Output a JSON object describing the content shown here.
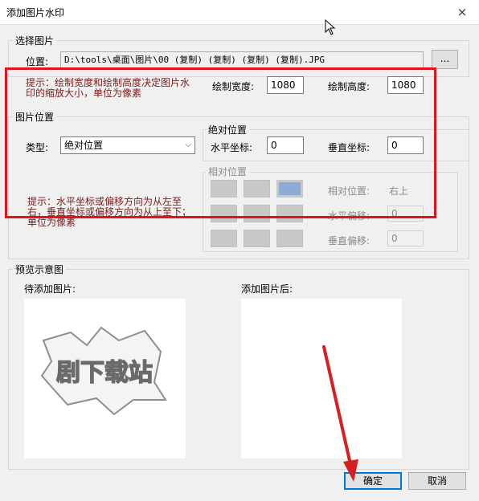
{
  "window": {
    "title": "添加图片水印",
    "close_icon": "×"
  },
  "select_image": {
    "legend": "选择图片",
    "location_label": "位置:",
    "path": "D:\\tools\\桌面\\图片\\00 (复制) (复制) (复制) (复制).JPG",
    "browse_label": "..."
  },
  "size_hint": "提示：绘制宽度和绘制高度决定图片水印的缩放大小，单位为像素",
  "width_label": "绘制宽度:",
  "width_value": "1080",
  "height_label": "绘制高度:",
  "height_value": "1080",
  "position": {
    "legend": "图片位置",
    "type_label": "类型:",
    "type_value": "绝对位置",
    "absolute": {
      "legend": "绝对位置",
      "x_label": "水平坐标:",
      "x_value": "0",
      "y_label": "垂直坐标:",
      "y_value": "0"
    },
    "relative": {
      "legend": "相对位置",
      "rel_label": "相对位置:",
      "rel_value": "右上",
      "h_offset_label": "水平偏移:",
      "h_offset_value": "0",
      "v_offset_label": "垂直偏移:",
      "v_offset_value": "0"
    },
    "hint": "提示：水平坐标或偏移方向为从左至右，垂直坐标或偏移方向为从上至下；单位为像素"
  },
  "preview": {
    "legend": "预览示意图",
    "before_label": "待添加图片:",
    "after_label": "添加图片后:",
    "logo_text": "剧下载站"
  },
  "ok_label": "确定",
  "cancel_label": "取消",
  "colors": {
    "highlight": "#e0141e",
    "hint_text": "#7a1a1a",
    "selected_tile": "#8cabd6",
    "focus": "#0078d7"
  }
}
